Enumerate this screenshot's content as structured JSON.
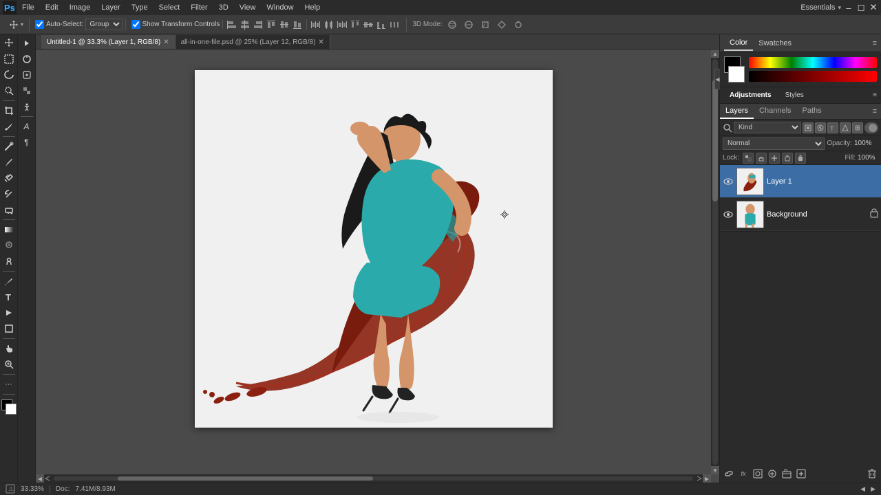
{
  "app": {
    "title": "Adobe Photoshop"
  },
  "menubar": {
    "items": [
      "PS",
      "File",
      "Edit",
      "Image",
      "Layer",
      "Type",
      "Select",
      "Filter",
      "3D",
      "View",
      "Window",
      "Help"
    ]
  },
  "toolbar": {
    "autoselect_label": "Auto-Select:",
    "autoselect_checked": true,
    "group_label": "Group",
    "show_transform_label": "Show Transform Controls",
    "show_transform_checked": true,
    "align_btns": [
      "⬛",
      "⬛",
      "⬛",
      "⬛",
      "⬛",
      "⬛",
      "⬛",
      "⬛",
      "⬛",
      "⬛",
      "⬛",
      "⬛",
      "⬛"
    ],
    "mode_label": "3D Mode:",
    "essentials_label": "Essentials",
    "workspace_arrow": "▾"
  },
  "tabs": [
    {
      "label": "Untitled-1 @ 33.3% (Layer 1, RGB/8)",
      "active": true,
      "modified": false
    },
    {
      "label": "all-in-one-file.psd @ 25% (Layer 12, RGB/8)",
      "active": false,
      "modified": true
    }
  ],
  "status_bar": {
    "zoom": "33.33%",
    "doc_label": "Doc:",
    "doc_size": "7.41M/8.93M"
  },
  "panels": {
    "color_tab": "Color",
    "swatches_tab": "Swatches",
    "adjustments_tab": "Adjustments",
    "styles_tab": "Styles",
    "layers_tab": "Layers",
    "channels_tab": "Channels",
    "paths_tab": "Paths"
  },
  "layers": {
    "filter_label": "Kind",
    "blend_mode": "Normal",
    "opacity_label": "Opacity:",
    "opacity_value": "100%",
    "lock_label": "Lock:",
    "fill_label": "Fill:",
    "fill_value": "100%",
    "items": [
      {
        "name": "Layer 1",
        "visible": true,
        "locked": false,
        "selected": true
      },
      {
        "name": "Background",
        "visible": true,
        "locked": true,
        "selected": false
      }
    ]
  },
  "bottom_bar": {
    "buttons": [
      "🔗",
      "fx",
      "⬛",
      "🔵",
      "📁",
      "🗑"
    ]
  },
  "tools": {
    "left": [
      "✛",
      "⬚",
      "↗",
      "✂",
      "✏",
      "⬚",
      "T",
      "⬚",
      "⬚",
      "⬚",
      "⬚",
      "⬚",
      "⬚",
      "⬚",
      "⬚",
      "⬚",
      "⬚",
      "⬚",
      "⬚",
      "🔍",
      "⋯"
    ],
    "right": [
      "▶",
      "⬚",
      "⬚",
      "⬚",
      "⬚",
      "A",
      "¶"
    ]
  },
  "icons": {
    "eye": "👁",
    "lock": "🔒",
    "link": "🔗",
    "fx": "fx",
    "new_layer": "📄",
    "folder": "📁",
    "trash": "🗑",
    "filter_on": "●",
    "menu": "≡",
    "collapse": "◀",
    "expand": "▶"
  }
}
